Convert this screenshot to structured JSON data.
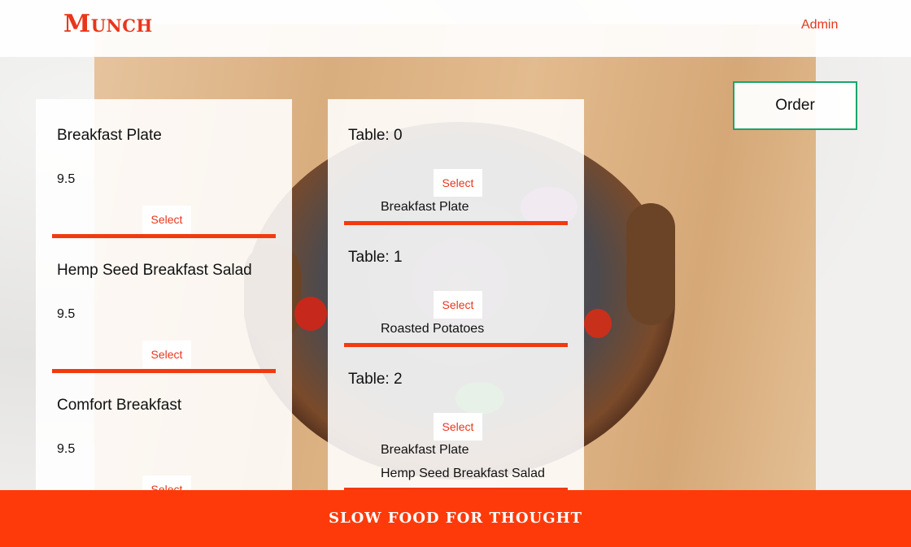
{
  "header": {
    "logo": "Munch",
    "admin_link": "Admin"
  },
  "menu": {
    "items": [
      {
        "name": "Breakfast Plate",
        "price": "9.5",
        "select_label": "Select"
      },
      {
        "name": "Hemp Seed Breakfast Salad",
        "price": "9.5",
        "select_label": "Select"
      },
      {
        "name": "Comfort Breakfast",
        "price": "9.5",
        "select_label": "Select"
      }
    ]
  },
  "tables": [
    {
      "label": "Table: 0",
      "select_label": "Select",
      "items": [
        "Breakfast Plate"
      ]
    },
    {
      "label": "Table: 1",
      "select_label": "Select",
      "items": [
        "Roasted Potatoes"
      ]
    },
    {
      "label": "Table: 2",
      "select_label": "Select",
      "items": [
        "Breakfast Plate",
        "Hemp Seed Breakfast Salad"
      ]
    }
  ],
  "order_button": "Order",
  "footer": {
    "tagline": "SLOW FOOD FOR THOUGHT"
  },
  "colors": {
    "accent": "#e8361b",
    "footer_bg": "#ff3a0a",
    "order_border": "#1aa56a"
  }
}
